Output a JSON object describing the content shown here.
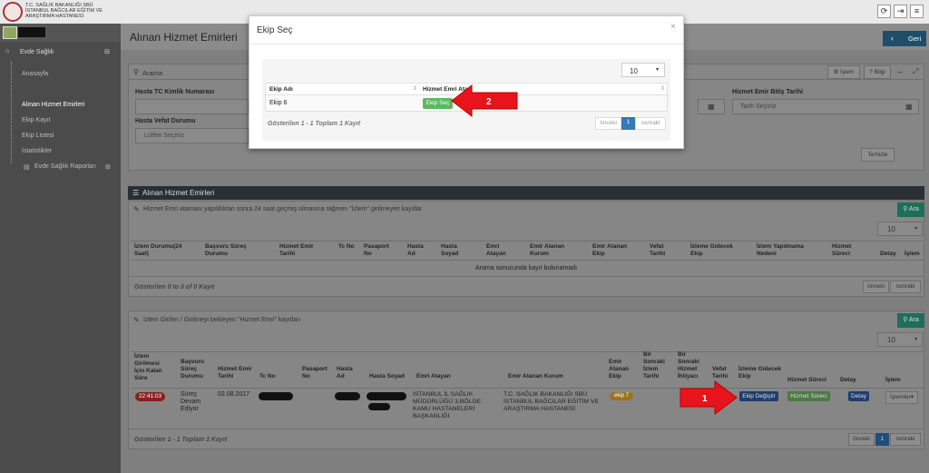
{
  "header": {
    "org_line1": "T.C. SAĞLIK BAKANLIĞI SBÜ",
    "org_line2": "İSTANBUL BAĞCILAR EĞİTİM VE",
    "org_line3": "ARAŞTIRMA HASTANESİ",
    "icons": [
      "refresh-icon",
      "logout-icon",
      "menu-icon"
    ]
  },
  "sidebar": {
    "section": "Evde Sağlık",
    "items": [
      {
        "label": "Anasayfa"
      },
      {
        "label": "Alınan Hizmet Emirleri"
      },
      {
        "label": "Ekip Kayıt"
      },
      {
        "label": "Ekip Listesi"
      },
      {
        "label": "İstatistikler"
      },
      {
        "label": "Evde Sağlık Raporları"
      }
    ]
  },
  "page": {
    "title": "Alınan Hizmet Emirleri",
    "back_label": "Geri"
  },
  "search": {
    "title": "Arama",
    "islem_label": "İşlem",
    "bilgi_label": "Bilgi",
    "tc_label": "Hasta TC Kimlik Numarası",
    "vefat_label": "Hasta Vefat Durumu",
    "vefat_value": "Lütfen Seçiniz",
    "bitis_label": "Hizmet Emir Bitiş Tarihi",
    "bitis_placeholder": "Tarih Seçiniz",
    "clear_label": "Temizle"
  },
  "section1": {
    "title": "Alınan Hizmet Emirleri",
    "subtitle": "Hizmet Emri ataması yapıldıktan sonra 24 saat geçmiş olmasına rağmen \"İzlem\" girilmeyeri kayıtlar",
    "search_btn": "Ara",
    "page_size": "10",
    "columns": [
      "İzlem Durumu(24 Saat)",
      "Başvuru Süreç Durumu",
      "Hizmet Emir Tarihi",
      "Tc No",
      "Pasaport No",
      "Hasta Ad",
      "Hasta Soyad",
      "Emri Atayan",
      "Emir Atanan Kurum",
      "Emir Atanan Ekip",
      "Vefat Tarihi",
      "İzleme Gidecek Ekip",
      "İzlem Yapılmama Nedeni",
      "Hizmet Süreci",
      "Detay",
      "İşlem"
    ],
    "empty_text": "Arama sonucunda kayıt bulunamadı",
    "footer": "Gösterilen 0 to 0 of 0 Kayıt",
    "prev": "önceki",
    "next": "sonraki"
  },
  "section2": {
    "title": "İzlem Girilen / Girilmeyi bekleyen \"Hizmet Emri\" kayıtları",
    "search_btn": "Ara",
    "page_size": "10",
    "columns": [
      "İzlem Girilmesi İçin Kalan Süre",
      "Başvuru Süreç Durumu",
      "Hizmet Emir Tarihi",
      "Tc No",
      "Pasaport No",
      "Hasta Ad",
      "Hasta Soyad",
      "Emri Atayan",
      "Emir Atanan Kurum",
      "Emir Atanan Ekip",
      "Bir Sonraki İzlem Tarihi",
      "Bir Sonraki Hizmet İhtiyacı",
      "Vefat Tarihi",
      "İzleme Gidecek Ekip",
      "Hizmet Süreci",
      "Detay",
      "İşlem"
    ],
    "row": {
      "kalan": "22:41:03",
      "surec": "Süreç Devam Ediyor",
      "tarih": "02.08.2017",
      "emri_atayan": "İSTANBUL İL SAĞLIK MÜDÜRLÜĞÜ 3.BÖLGE KAMU HASTANELERİ BAŞKANLIĞI",
      "kurum": "T.C. SAĞLIK BAKANLIĞI SBÜ İSTANBUL BAĞCILAR EĞİTİM VE ARAŞTIRMA HASTANESİ",
      "ekip": "ekip 7",
      "ekip_degistir": "Ekip Değiştir",
      "hizmet_sureci": "Hizmet Süreci",
      "detay": "Detay",
      "islemler": "İşlemler"
    },
    "footer": "Gösterilen 1 - 1 Toplam 1 Kayıt",
    "prev": "önceki",
    "page": "1",
    "next": "sonraki"
  },
  "modal": {
    "title": "Ekip Seç",
    "page_size": "10",
    "col_ekip": "Ekip Adı",
    "col_ata": "Hizmet Emri Ata",
    "row_ekip": "Ekip 6",
    "select_btn": "Ekip Seç",
    "footer": "Gösterilen 1 - 1 Toplam 1 Kayıt",
    "prev": "önceki",
    "page": "1",
    "next": "sonraki"
  },
  "annotations": {
    "arrow1": "1",
    "arrow2": "2"
  },
  "colors": {
    "accent": "#1f4e78",
    "arrow": "#e8141b",
    "select_btn": "#5cb85c"
  }
}
